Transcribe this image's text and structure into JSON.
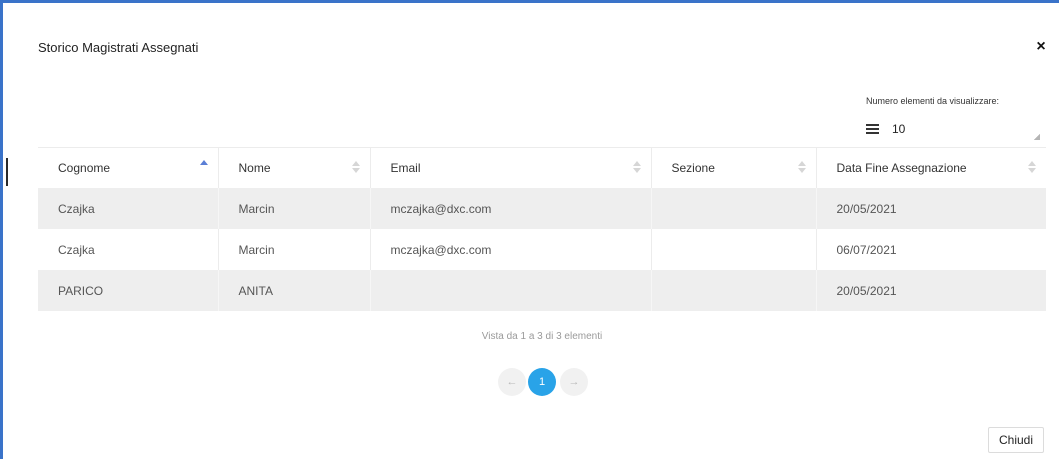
{
  "modal": {
    "title": "Storico Magistrati Assegnati",
    "close_icon": "×"
  },
  "page_size": {
    "label": "Numero elementi da visualizzare:",
    "value": "10",
    "icon": "menu-icon"
  },
  "table": {
    "columns": [
      {
        "label": "Cognome",
        "sort": "asc"
      },
      {
        "label": "Nome",
        "sort": "none"
      },
      {
        "label": "Email",
        "sort": "none"
      },
      {
        "label": "Sezione",
        "sort": "none"
      },
      {
        "label": "Data Fine Assegnazione",
        "sort": "none"
      }
    ],
    "rows": [
      [
        "Czajka",
        "Marcin",
        "mczajka@dxc.com",
        "",
        "20/05/2021"
      ],
      [
        "Czajka",
        "Marcin",
        "mczajka@dxc.com",
        "",
        "06/07/2021"
      ],
      [
        "PARICO",
        "ANITA",
        "",
        "",
        "20/05/2021"
      ]
    ]
  },
  "pagination": {
    "info": "Vista da 1 a 3 di 3 elementi",
    "prev": "←",
    "current": "1",
    "next": "→"
  },
  "footer": {
    "close_button_label": "Chiudi"
  },
  "colors": {
    "frame": "#3a73c9",
    "accent_page": "#29a3e8",
    "sort_active": "#5b7fd6",
    "row_stripe": "#eeeeee"
  }
}
